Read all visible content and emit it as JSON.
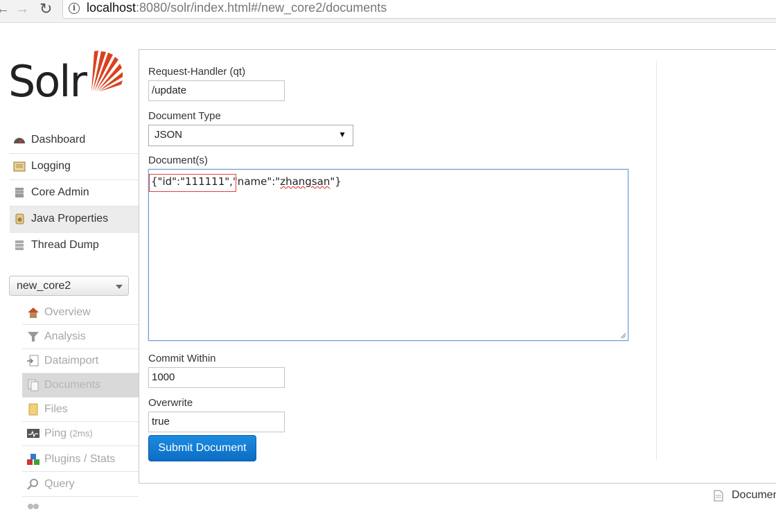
{
  "browser": {
    "url_host": "localhost",
    "url_rest": ":8080/solr/index.html#/new_core2/documents"
  },
  "logo": {
    "text": "Solr"
  },
  "menu": [
    {
      "label": "Dashboard",
      "icon": "dashboard-icon"
    },
    {
      "label": "Logging",
      "icon": "logging-icon"
    },
    {
      "label": "Core Admin",
      "icon": "core-admin-icon"
    },
    {
      "label": "Java Properties",
      "icon": "java-icon",
      "active": true
    },
    {
      "label": "Thread Dump",
      "icon": "thread-dump-icon"
    }
  ],
  "core_selector": {
    "value": "new_core2"
  },
  "core_menu": [
    {
      "label": "Overview",
      "icon": "home-icon"
    },
    {
      "label": "Analysis",
      "icon": "funnel-icon"
    },
    {
      "label": "Dataimport",
      "icon": "dataimport-icon"
    },
    {
      "label": "Documents",
      "icon": "documents-icon",
      "active": true
    },
    {
      "label": "Files",
      "icon": "files-icon"
    },
    {
      "label": "Ping",
      "suffix": "(2ms)",
      "icon": "ping-icon"
    },
    {
      "label": "Plugins / Stats",
      "icon": "plugins-icon"
    },
    {
      "label": "Query",
      "icon": "query-icon"
    }
  ],
  "form": {
    "request_handler_label": "Request-Handler (qt)",
    "request_handler_value": "/update",
    "document_type_label": "Document Type",
    "document_type_value": "JSON",
    "documents_label": "Document(s)",
    "documents_part1": "{\"id\":\"111111\",\"name\":\"",
    "documents_spell": "zhangsan",
    "documents_part2": "\"}",
    "commit_within_label": "Commit Within",
    "commit_within_value": "1000",
    "overwrite_label": "Overwrite",
    "overwrite_value": "true",
    "submit_label": "Submit Document"
  },
  "footer": {
    "label": "Documen"
  },
  "colors": {
    "accent": "#1c8ce0",
    "logo_red": "#d9411e",
    "highlight": "#e04040"
  }
}
